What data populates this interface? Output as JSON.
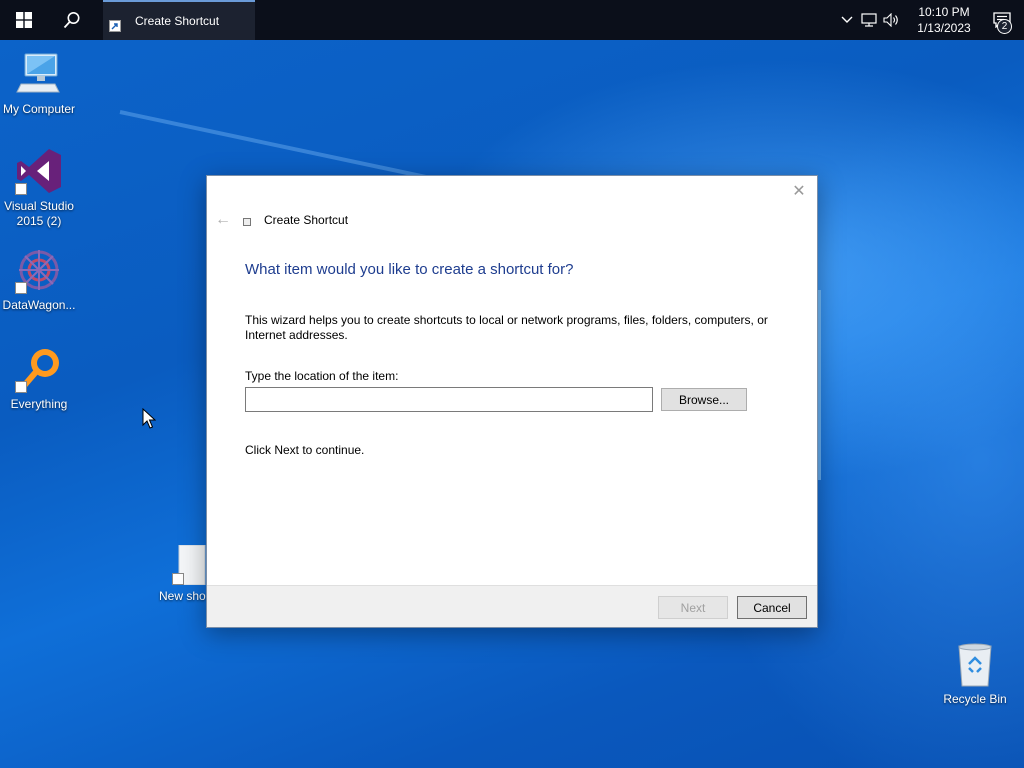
{
  "taskbar": {
    "task_title": "Create Shortcut",
    "clock_time": "10:10 PM",
    "clock_date": "1/13/2023",
    "notification_count": "2"
  },
  "desktop": {
    "icons": [
      {
        "label": "My Computer"
      },
      {
        "label": "Visual Studio 2015 (2)"
      },
      {
        "label": "DataWagon..."
      },
      {
        "label": "Everything"
      },
      {
        "label": "New sho"
      },
      {
        "label": "Recycle Bin"
      }
    ]
  },
  "dialog": {
    "title": "Create Shortcut",
    "close_glyph": "✕",
    "back_glyph": "←",
    "heading": "What item would you like to create a shortcut for?",
    "description": "This wizard helps you to create shortcuts to local or network programs, files, folders, computers, or Internet addresses.",
    "location_label": "Type the location of the item:",
    "location_value": "",
    "browse_label": "Browse...",
    "continue_text": "Click Next to continue.",
    "next_label": "Next",
    "cancel_label": "Cancel"
  },
  "colors": {
    "heading": "#1e3d8f",
    "taskbar": "#0b0f1a",
    "desktop_blue": "#0a5fc4"
  }
}
